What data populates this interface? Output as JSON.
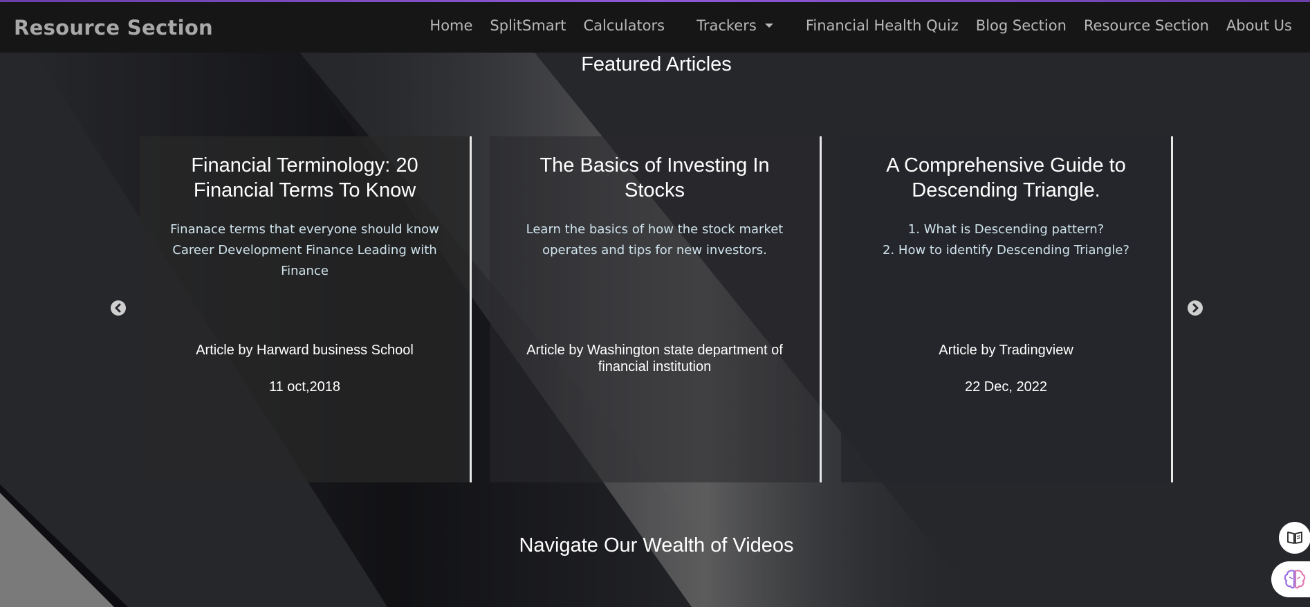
{
  "navbar": {
    "brand": "Resource Section",
    "items": [
      {
        "label": "Home"
      },
      {
        "label": "SplitSmart"
      },
      {
        "label": "Calculators"
      },
      {
        "label": "Trackers"
      },
      {
        "label": "Financial Health Quiz"
      },
      {
        "label": "Blog Section"
      },
      {
        "label": "Resource Section"
      },
      {
        "label": "About Us"
      }
    ]
  },
  "featured": {
    "title": "Featured Articles",
    "articles": [
      {
        "title": "Financial Terminology: 20 Financial Terms To Know",
        "description": "Finanace terms that everyone should know Career Development Finance Leading with Finance",
        "author": "Article by Harward business School",
        "date": "11 oct,2018"
      },
      {
        "title": "The Basics of Investing In Stocks",
        "description": "Learn the basics of how the stock market operates and tips for new investors.",
        "author": "Article by Washington state department of financial institution",
        "date": ""
      },
      {
        "title": "A Comprehensive Guide to Descending Triangle.",
        "description_lines": [
          "1. What is Descending pattern?",
          "2. How to identify Descending Triangle?"
        ],
        "author": "Article by Tradingview",
        "date": "22 Dec, 2022"
      }
    ]
  },
  "videos": {
    "title": "Navigate Our Wealth of Videos"
  },
  "icons": {
    "prev": "chevron-left-circle-icon",
    "next": "chevron-right-circle-icon",
    "trackers_dropdown": "caret-down-icon",
    "book": "book-open-icon",
    "brain": "brain-icon"
  },
  "colors": {
    "accent_bar": "#8e59d6",
    "navbar_bg": "#161616",
    "brand_text": "#a9a9a9",
    "page_bg": "#26272b",
    "card_desc": "#cfe3ec",
    "brain_icon": "#9b6fe0"
  }
}
